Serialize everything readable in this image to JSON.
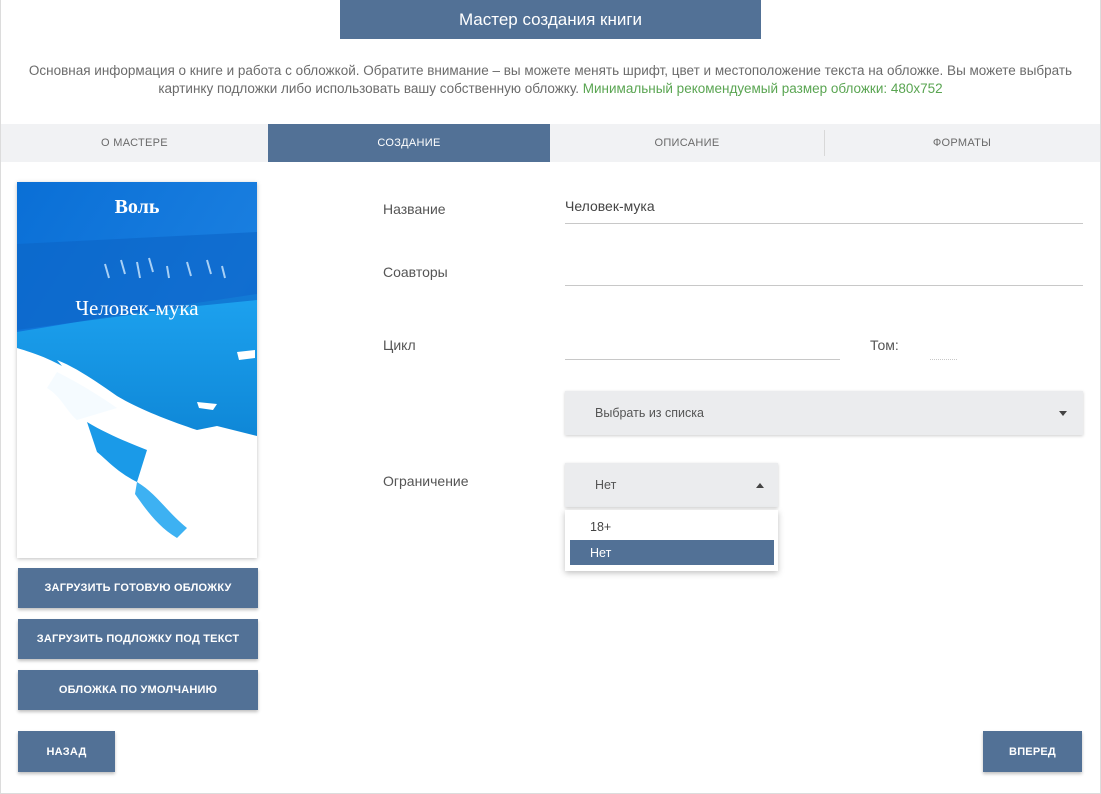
{
  "header": {
    "title": "Мастер создания книги"
  },
  "intro": {
    "text": "Основная информация о книге и работа с обложкой. Обратите внимание – вы можете менять шрифт, цвет и местоположение текста на обложке. Вы можете выбрать картинку подложки либо использовать вашу собственную обложку.",
    "hint": "Минимальный рекомендуемый размер обложки: 480x752"
  },
  "tabs": [
    {
      "label": "О МАСТЕРЕ"
    },
    {
      "label": "СОЗДАНИЕ"
    },
    {
      "label": "ОПИСАНИЕ"
    },
    {
      "label": "ФОРМАТЫ"
    }
  ],
  "cover": {
    "author": "Воль",
    "title": "Человек-мука"
  },
  "cover_buttons": {
    "upload_cover": "ЗАГРУЗИТЬ ГОТОВУЮ ОБЛОЖКУ",
    "upload_background": "ЗАГРУЗИТЬ ПОДЛОЖКУ ПОД ТЕКСТ",
    "default_cover": "ОБЛОЖКА ПО УМОЛЧАНИЮ"
  },
  "form": {
    "title_label": "Название",
    "title_value": "Человек-мука",
    "coauthors_label": "Соавторы",
    "coauthors_value": "",
    "cycle_label": "Цикл",
    "cycle_value": "",
    "volume_label": "Том:",
    "volume_value": "",
    "cycle_select": "Выбрать из списка",
    "restriction_label": "Ограничение",
    "restriction_value": "Нет",
    "restriction_options": [
      "18+",
      "Нет"
    ]
  },
  "nav": {
    "back": "НАЗАД",
    "next": "ВПЕРЕД"
  },
  "colors": {
    "accent": "#527196",
    "hint": "#5aa552",
    "tab_bg": "#f1f2f4"
  }
}
